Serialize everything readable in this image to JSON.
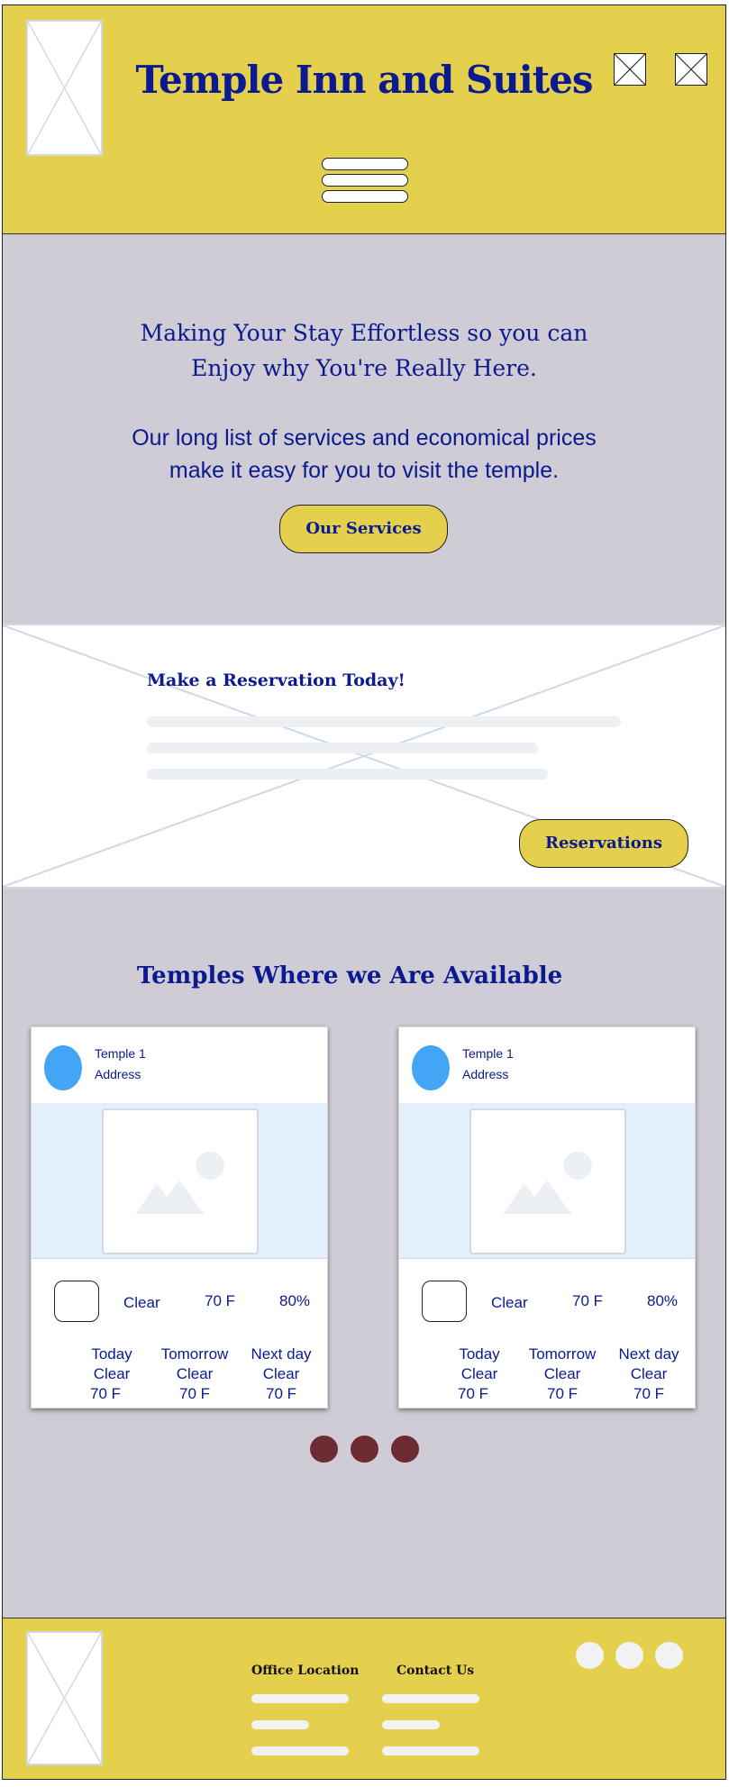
{
  "header": {
    "title": "Temple Inn and Suites",
    "logo": "image-placeholder",
    "right_icons": [
      "image-placeholder-icon",
      "image-placeholder-icon"
    ],
    "menu_icon": "hamburger-menu-icon"
  },
  "hero": {
    "title_line1": "Making Your Stay Effortless so you can",
    "title_line2": "Enjoy why You're Really Here.",
    "subtitle_line1": "Our long list of services and economical prices",
    "subtitle_line2": "make it easy for you to visit the temple.",
    "button_label": "Our Services"
  },
  "reservation": {
    "title": "Make a Reservation Today!",
    "button_label": "Reservations"
  },
  "temples": {
    "title": "Temples Where we Are Available",
    "cards": [
      {
        "name": "Temple 1",
        "address": "Address",
        "condition": "Clear",
        "temperature": "70 F",
        "humidity": "80%",
        "forecast": [
          {
            "day": "Today",
            "condition": "Clear",
            "temp": "70 F"
          },
          {
            "day": "Tomorrow",
            "condition": "Clear",
            "temp": "70 F"
          },
          {
            "day": "Next day",
            "condition": "Clear",
            "temp": "70 F"
          }
        ]
      },
      {
        "name": "Temple 1",
        "address": "Address",
        "condition": "Clear",
        "temperature": "70 F",
        "humidity": "80%",
        "forecast": [
          {
            "day": "Today",
            "condition": "Clear",
            "temp": "70 F"
          },
          {
            "day": "Tomorrow",
            "condition": "Clear",
            "temp": "70 F"
          },
          {
            "day": "Next day",
            "condition": "Clear",
            "temp": "70 F"
          }
        ]
      }
    ]
  },
  "footer": {
    "office_heading": "Office Location",
    "contact_heading": "Contact Us"
  },
  "colors": {
    "brand_yellow": "#e4d04c",
    "navy_text": "#0b1a8f",
    "section_gray": "#cfccd6",
    "avatar_blue": "#42a5f5",
    "carousel_dot": "#6d2b33"
  }
}
